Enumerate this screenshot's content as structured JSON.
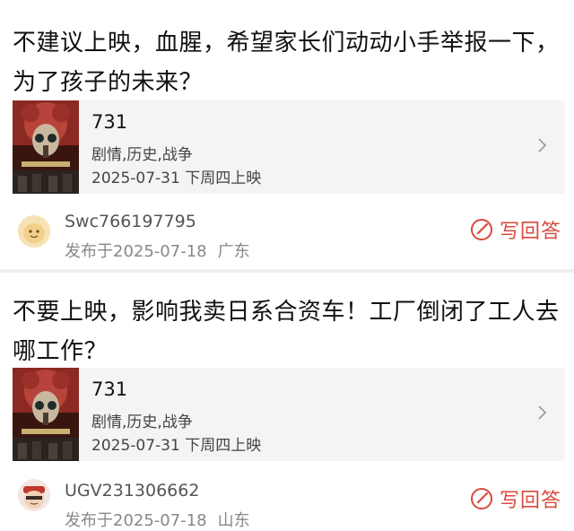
{
  "posts": [
    {
      "question": "不建议上映，血腥，希望家长们动动小手举报一下，为了孩子的未来？",
      "movie": {
        "title": "731",
        "genres": "剧情,历史,战争",
        "release": "2025-07-31 下周四上映"
      },
      "user": {
        "name": "Swc766197795",
        "published": "发布于2025-07-18",
        "region": "广东"
      },
      "answer_label": "写回答"
    },
    {
      "question": "不要上映，影响我卖日系合资车！工厂倒闭了工人去哪工作？",
      "movie": {
        "title": "731",
        "genres": "剧情,历史,战争",
        "release": "2025-07-31 下周四上映"
      },
      "user": {
        "name": "UGV231306662",
        "published": "发布于2025-07-18",
        "region": "山东"
      },
      "answer_label": "写回答"
    }
  ],
  "colors": {
    "accent": "#d94a3b",
    "card_bg": "#f4f4f4",
    "separator": "#eeeeee"
  },
  "icons": {
    "chevron": "chevron-right-icon",
    "answer": "edit-circle-icon"
  }
}
